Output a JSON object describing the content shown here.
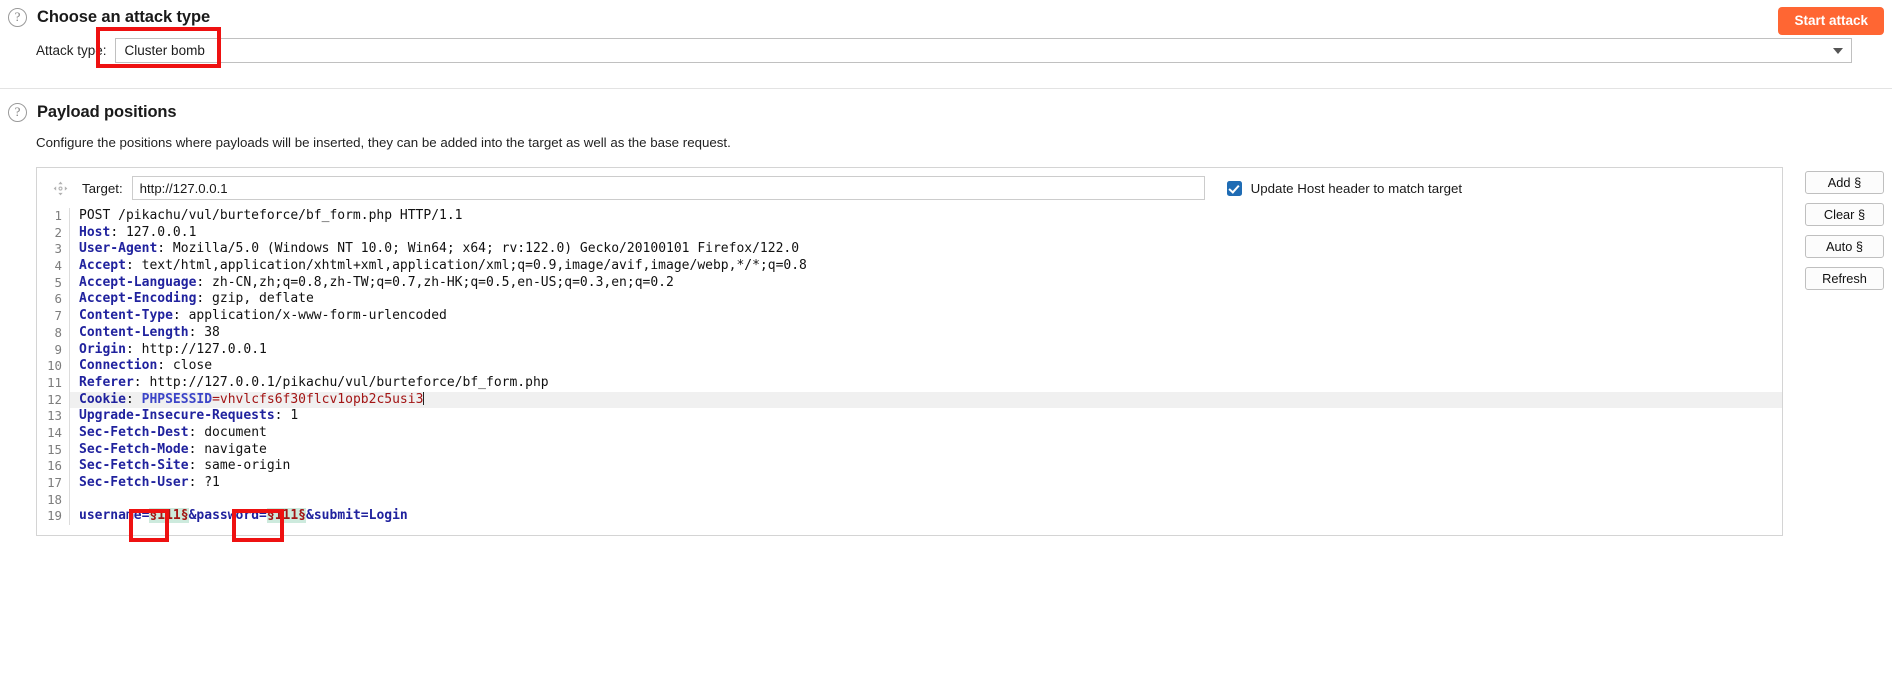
{
  "attack_section": {
    "title": "Choose an attack type",
    "help_icon": "question-mark-circle-icon",
    "attack_type_label": "Attack type:",
    "attack_type_value": "Cluster bomb",
    "start_attack_label": "Start attack",
    "accent_color": "#ff6633",
    "annotation_color": "#ee1111"
  },
  "payload_section": {
    "title": "Payload positions",
    "help_icon": "question-mark-circle-icon",
    "description": "Configure the positions where payloads will be inserted, they can be added into the target as well as the base request.",
    "target_label": "Target:",
    "target_value": "http://127.0.0.1",
    "move_icon": "move-cross-icon",
    "host_checkbox_label": "Update Host header to match target",
    "host_checkbox_checked": true,
    "checkbox_color": "#1f6cb4",
    "buttons": [
      {
        "label": "Add §",
        "name": "add-payload-marker-button"
      },
      {
        "label": "Clear §",
        "name": "clear-payload-marker-button"
      },
      {
        "label": "Auto §",
        "name": "auto-payload-marker-button"
      },
      {
        "label": "Refresh",
        "name": "refresh-button"
      }
    ]
  },
  "request": {
    "lines": [
      {
        "n": "1",
        "text": "POST /pikachu/vul/burteforce/bf_form.php HTTP/1.1"
      },
      {
        "n": "2",
        "header": "Host",
        "text": ": 127.0.0.1"
      },
      {
        "n": "3",
        "header": "User-Agent",
        "text": ": Mozilla/5.0 (Windows NT 10.0; Win64; x64; rv:122.0) Gecko/20100101 Firefox/122.0"
      },
      {
        "n": "4",
        "header": "Accept",
        "text": ": text/html,application/xhtml+xml,application/xml;q=0.9,image/avif,image/webp,*/*;q=0.8"
      },
      {
        "n": "5",
        "header": "Accept-Language",
        "text": ": zh-CN,zh;q=0.8,zh-TW;q=0.7,zh-HK;q=0.5,en-US;q=0.3,en;q=0.2"
      },
      {
        "n": "6",
        "header": "Accept-Encoding",
        "text": ": gzip, deflate"
      },
      {
        "n": "7",
        "header": "Content-Type",
        "text": ": application/x-www-form-urlencoded"
      },
      {
        "n": "8",
        "header": "Content-Length",
        "text": ": 38"
      },
      {
        "n": "9",
        "header": "Origin",
        "text": ": http://127.0.0.1"
      },
      {
        "n": "10",
        "header": "Connection",
        "text": ": close"
      },
      {
        "n": "11",
        "header": "Referer",
        "text": ": http://127.0.0.1/pikachu/vul/burteforce/bf_form.php"
      },
      {
        "n": "12",
        "header": "Cookie",
        "cookie_name": "PHPSESSID",
        "cookie_value": "=vhvlcfs6f30flcv1opb2c5usi3",
        "text": ": ",
        "highlight": true
      },
      {
        "n": "13",
        "header": "Upgrade-Insecure-Requests",
        "text": ": 1"
      },
      {
        "n": "14",
        "header": "Sec-Fetch-Dest",
        "text": ": document"
      },
      {
        "n": "15",
        "header": "Sec-Fetch-Mode",
        "text": ": navigate"
      },
      {
        "n": "16",
        "header": "Sec-Fetch-Site",
        "text": ": same-origin"
      },
      {
        "n": "17",
        "header": "Sec-Fetch-User",
        "text": ": ?1"
      },
      {
        "n": "18",
        "text": ""
      },
      {
        "n": "19",
        "body": true
      }
    ],
    "body_parts": [
      {
        "t": "username=",
        "style": "hdr"
      },
      {
        "t": "§111§",
        "style": "marker"
      },
      {
        "t": "&password=",
        "style": "hdr"
      },
      {
        "t": "§111§",
        "style": "marker"
      },
      {
        "t": "&submit=Login",
        "style": "hdr"
      }
    ],
    "marker_highlight_color": "#cdeadd",
    "header_color": "#20229e"
  }
}
